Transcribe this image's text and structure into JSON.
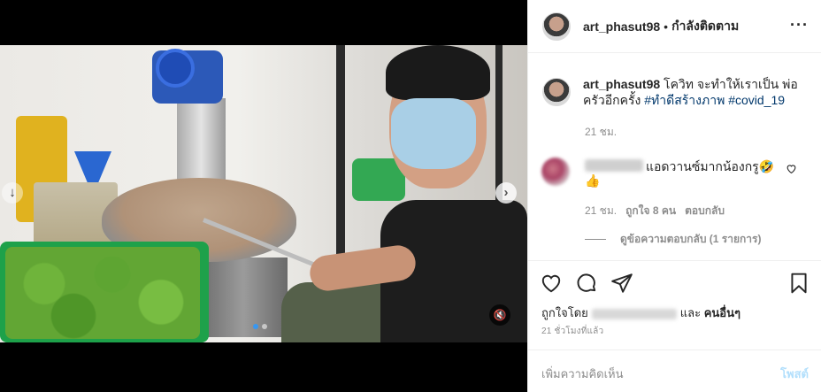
{
  "post": {
    "username": "art_phasut98",
    "separator": "•",
    "follow_status": "กำลังติดตาม",
    "more_icon": "more-horizontal-icon"
  },
  "caption": {
    "username": "art_phasut98",
    "text": "โควิท จะทำให้เราเป็น พ่อครัวอีกครั้ง",
    "hashtags": [
      "#ทำดีสร้างภาพ",
      "#covid_19"
    ],
    "time": "21 ชม."
  },
  "comment": {
    "text": "แอดวานซ์มากน้องกรู🤣",
    "emoji": "👍",
    "time": "21 ชม.",
    "likes": "ถูกใจ 8 คน",
    "reply": "ตอบกลับ",
    "view_replies": "ดูข้อความตอบกลับ (1 รายการ)"
  },
  "media": {
    "carousel_dots": 2,
    "active_dot": 0,
    "next_symbol": "›",
    "prev_symbol": "↓",
    "mute_symbol": "🔇"
  },
  "actions": {
    "liked_by_prefix": "ถูกใจโดย",
    "liked_by_suffix": "และ",
    "liked_by_others": "คนอื่นๆ",
    "posted_time": "21 ชั่วโมงที่แล้ว"
  },
  "add_comment": {
    "placeholder": "เพิ่มความคิดเห็น",
    "post_label": "โพสต์"
  }
}
